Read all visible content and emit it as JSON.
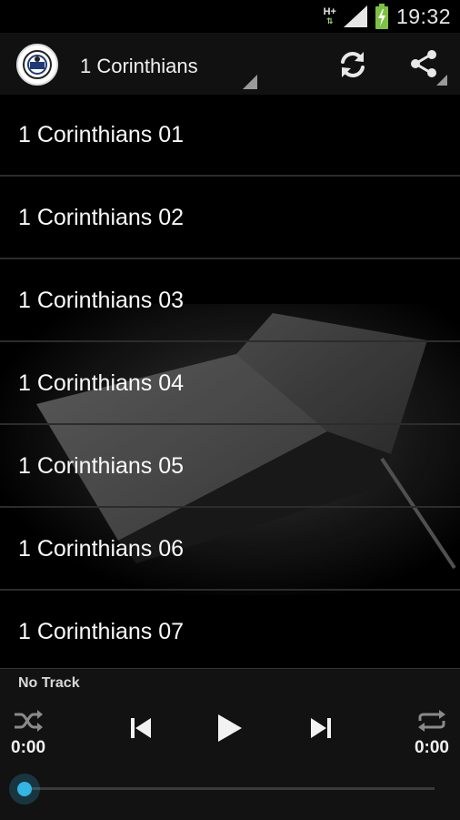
{
  "status_bar": {
    "network": "H+",
    "time": "19:32"
  },
  "action_bar": {
    "logo_icon": "app-logo-emblem",
    "title": "1 Corinthians",
    "refresh_icon": "refresh-icon",
    "share_icon": "share-icon"
  },
  "list": {
    "items": [
      {
        "label": "1 Corinthians 01"
      },
      {
        "label": "1 Corinthians 02"
      },
      {
        "label": "1 Corinthians 03"
      },
      {
        "label": "1 Corinthians 04"
      },
      {
        "label": "1 Corinthians 05"
      },
      {
        "label": "1 Corinthians 06"
      },
      {
        "label": "1 Corinthians 07"
      }
    ]
  },
  "player": {
    "track_title": "No Track",
    "elapsed": "0:00",
    "duration": "0:00",
    "progress": 0,
    "accent_color": "#33b5e5"
  }
}
